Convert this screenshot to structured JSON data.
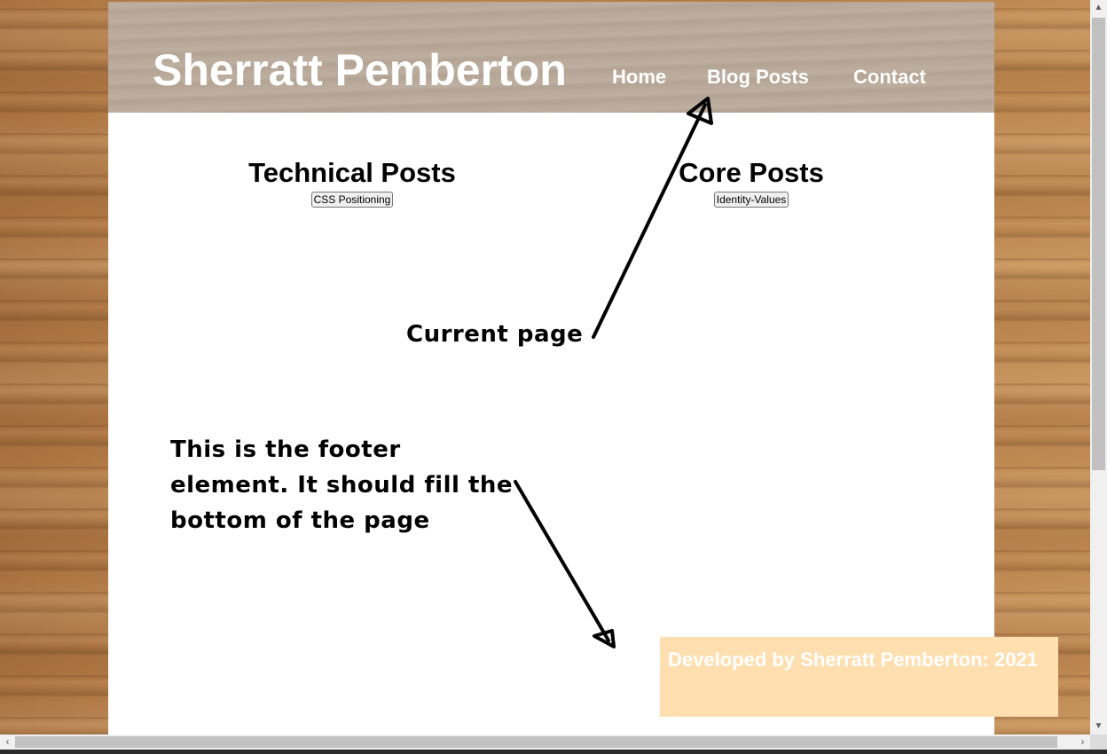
{
  "header": {
    "site_title": "Sherratt Pemberton",
    "nav": {
      "home": "Home",
      "blog_posts": "Blog Posts",
      "contact": "Contact"
    }
  },
  "main": {
    "technical": {
      "heading": "Technical Posts",
      "button": "CSS Positioning"
    },
    "core": {
      "heading": "Core Posts",
      "button": "Identity-Values"
    }
  },
  "annotations": {
    "current_page": "Current page",
    "footer_note": "This is the footer element. It should fill the bottom of the page"
  },
  "footer": {
    "text": "Developed by Sherratt Pemberton: 2021"
  },
  "colors": {
    "header_bg": "#b9aa9b",
    "footer_bg": "#ffdfb0",
    "text_on_color": "#ffffff"
  }
}
